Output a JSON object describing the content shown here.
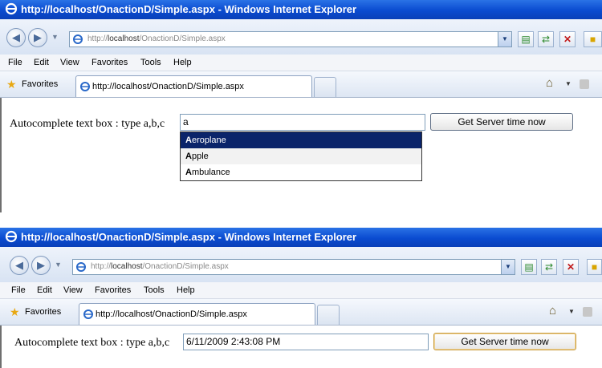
{
  "browser": {
    "title": "http://localhost/OnactionD/Simple.aspx - Windows Internet Explorer",
    "address_prefix": "http://",
    "address_host": "localhost",
    "address_path": "/OnactionD/Simple.aspx",
    "menu": [
      "File",
      "Edit",
      "View",
      "Favorites",
      "Tools",
      "Help"
    ],
    "favorites_label": "Favorites",
    "tab_label": "http://localhost/OnactionD/Simple.aspx"
  },
  "page": {
    "label": "Autocomplete text box : type a,b,c",
    "button_label": "Get Server time now"
  },
  "screenshot1": {
    "input_value": "a",
    "suggestions": [
      {
        "match": "A",
        "rest": "eroplane"
      },
      {
        "match": "A",
        "rest": "pple"
      },
      {
        "match": "A",
        "rest": "mbulance"
      }
    ]
  },
  "screenshot2": {
    "input_value": "6/11/2009 2:43:08 PM"
  },
  "colors": {
    "titlebar": "#0a4bd0",
    "selected_suggestion": "#0a246a"
  },
  "icons": [
    "ie-icon",
    "back-icon",
    "forward-icon",
    "page-icon",
    "compat-icon",
    "refresh-icon",
    "stop-icon",
    "live-search-icon",
    "favorites-star-icon",
    "home-icon",
    "feed-icon"
  ]
}
